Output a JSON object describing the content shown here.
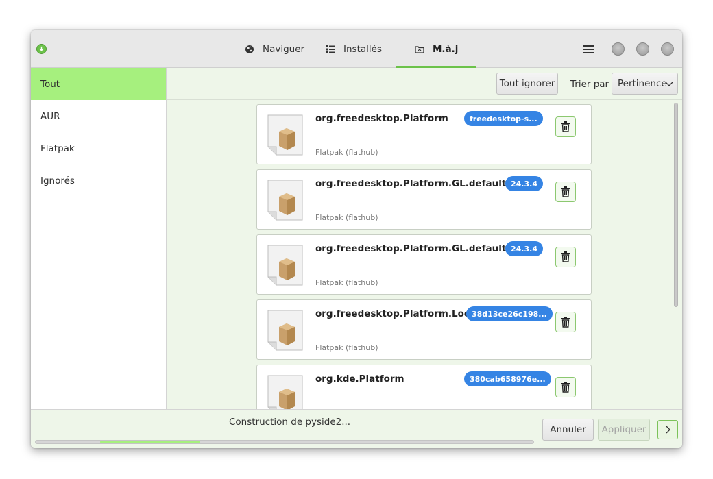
{
  "header": {
    "tabs": [
      {
        "label": "Naviguer",
        "icon": "globe-icon"
      },
      {
        "label": "Installés",
        "icon": "list-icon"
      },
      {
        "label": "M.à.j",
        "icon": "folder-icon",
        "active": true
      }
    ],
    "accent": "#6cc24a"
  },
  "sidebar": {
    "items": [
      {
        "label": "Tout",
        "selected": true
      },
      {
        "label": "AUR"
      },
      {
        "label": "Flatpak"
      },
      {
        "label": "Ignorés"
      }
    ],
    "selected_color": "#a6f07e"
  },
  "toolbar": {
    "ignore_all_label": "Tout ignorer",
    "sort_label": "Trier par",
    "sort_value": "Pertinence"
  },
  "packages": [
    {
      "name": "org.freedesktop.Platform",
      "version": "freedesktop-s...",
      "source": "Flatpak (flathub)"
    },
    {
      "name": "org.freedesktop.Platform.GL.default",
      "version": "24.3.4",
      "source": "Flatpak (flathub)"
    },
    {
      "name": "org.freedesktop.Platform.GL.default",
      "version": "24.3.4",
      "source": "Flatpak (flathub)"
    },
    {
      "name": "org.freedesktop.Platform.Locale",
      "version": "38d13ce26c198...",
      "source": "Flatpak (flathub)"
    },
    {
      "name": "org.kde.Platform",
      "version": "380cab658976e...",
      "source": ""
    }
  ],
  "badge_color": "#3584e4",
  "footer": {
    "status": "Construction de pyside2...",
    "cancel_label": "Annuler",
    "apply_label": "Appliquer"
  }
}
